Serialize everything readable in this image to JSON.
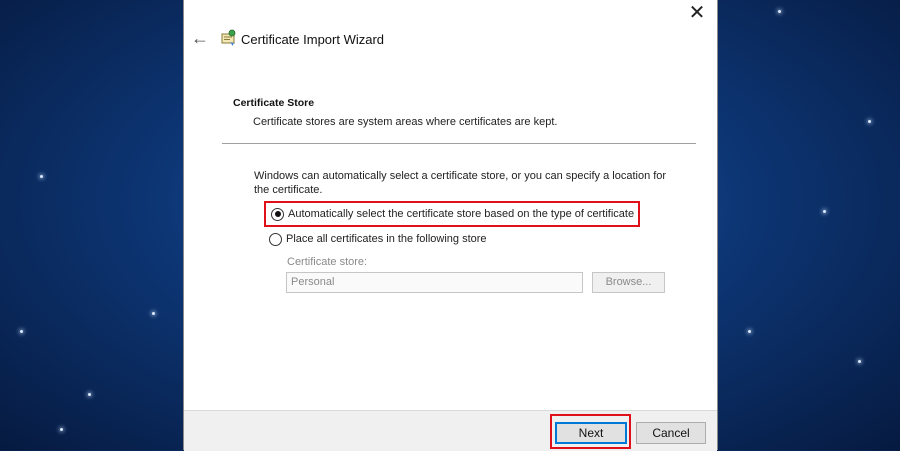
{
  "window": {
    "title": "Certificate Import Wizard",
    "close_glyph": "✕",
    "back_glyph": "←"
  },
  "section": {
    "title": "Certificate Store",
    "description": "Certificate stores are system areas where certificates are kept."
  },
  "info_text": "Windows can automatically select a certificate store, or you can specify a location for the certificate.",
  "options": [
    {
      "label": "Automatically select the certificate store based on the type of certificate",
      "checked": true
    },
    {
      "label": "Place all certificates in the following store",
      "checked": false
    }
  ],
  "store": {
    "label": "Certificate store:",
    "value": "Personal",
    "browse_label": "Browse..."
  },
  "footer": {
    "next_label": "Next",
    "cancel_label": "Cancel"
  },
  "colors": {
    "highlight": "#e0101a",
    "focus_blue": "#0078d7"
  }
}
